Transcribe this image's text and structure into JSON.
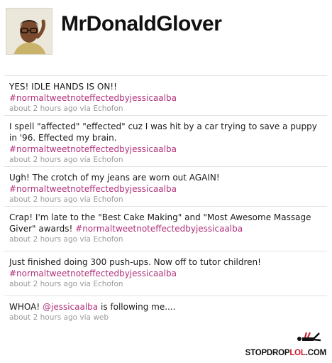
{
  "profile": {
    "username": "MrDonaldGlover"
  },
  "tweets": [
    {
      "text": "YES! IDLE HANDS IS ON!!",
      "hashtag": "#normaltweetnoteffectedbyjessicaalba",
      "time": "about 2 hours ago",
      "via": "via",
      "source": "Echofon"
    },
    {
      "text": "I spell \"affected\" \"effected\" cuz I was hit by a car trying to save a puppy in '96. Effected my brain.",
      "hashtag": "#normaltweetnoteffectedbyjessicaalba",
      "time": "about 2 hours ago",
      "via": "via",
      "source": "Echofon"
    },
    {
      "text": "Ugh! The crotch of my jeans are worn out AGAIN!",
      "hashtag": "#normaltweetnoteffectedbyjessicaalba",
      "time": "about 2 hours ago",
      "via": "via",
      "source": "Echofon"
    },
    {
      "text": "Crap! I'm late to the \"Best Cake Making\" and \"Most Awesome Massage Giver\" awards!",
      "hashtag": "#normaltweetnoteffectedbyjessicaalba",
      "time": "about 2 hours ago",
      "via": "via",
      "source": "Echofon"
    },
    {
      "text": "Just finished doing 300 push-ups. Now off to tutor children!",
      "hashtag": "#normaltweetnoteffectedbyjessicaalba",
      "time": "about 2 hours ago",
      "via": "via",
      "source": "Echofon"
    },
    {
      "text_before": "WHOA!",
      "mention": "@jessicaalba",
      "text_after": "is following me....",
      "time": "about 2 hours ago",
      "via": "via",
      "source": "web"
    }
  ],
  "watermark": {
    "brand_main": "STOPDROP",
    "brand_accent": "LOL",
    "brand_tld": ".COM",
    "accent_color": "#c41f2e"
  },
  "colors": {
    "hashtag": "#b0307a",
    "meta": "#9a9a9a",
    "divider": "#e2e2e2"
  },
  "icons": {
    "avatar": "profile-photo",
    "logo_mark": "stop-drop-figure-icon"
  }
}
